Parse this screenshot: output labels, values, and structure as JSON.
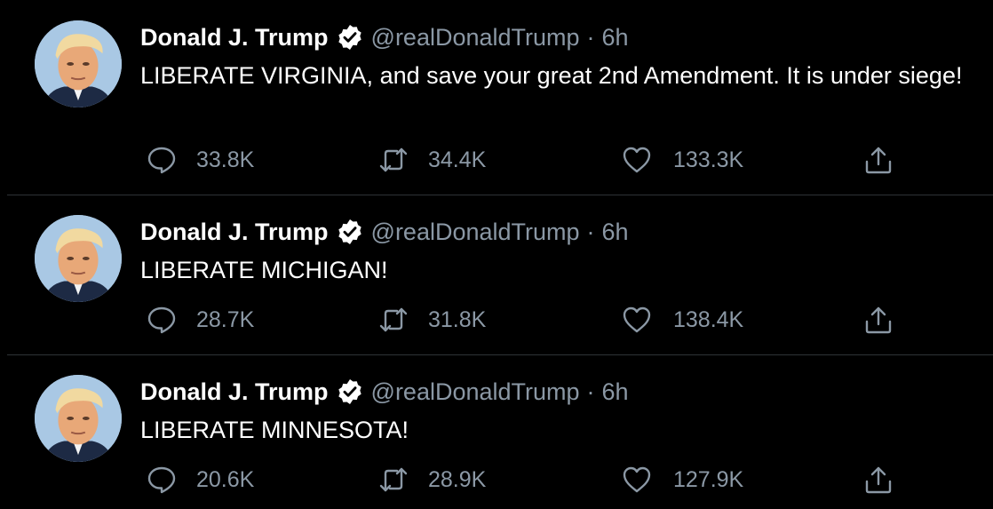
{
  "tweets": [
    {
      "author_name": "Donald J. Trump",
      "handle": "@realDonaldTrump",
      "separator": "·",
      "time": "6h",
      "text": "LIBERATE VIRGINIA, and save your great 2nd Amendment. It is under siege!",
      "replies": "33.8K",
      "retweets": "34.4K",
      "likes": "133.3K"
    },
    {
      "author_name": "Donald J. Trump",
      "handle": "@realDonaldTrump",
      "separator": "·",
      "time": "6h",
      "text": "LIBERATE MICHIGAN!",
      "replies": "28.7K",
      "retweets": "31.8K",
      "likes": "138.4K"
    },
    {
      "author_name": "Donald J. Trump",
      "handle": "@realDonaldTrump",
      "separator": "·",
      "time": "6h",
      "text": "LIBERATE MINNESOTA!",
      "replies": "20.6K",
      "retweets": "28.9K",
      "likes": "127.9K"
    }
  ],
  "icons": {
    "reply": "speech-bubble-icon",
    "retweet": "retweet-arrows-icon",
    "like": "heart-outline-icon",
    "share": "share-upload-icon",
    "verified": "verified-badge-icon"
  },
  "colors": {
    "background": "#000000",
    "text": "#ffffff",
    "muted": "#8b98a5",
    "divider": "#2f3336"
  }
}
